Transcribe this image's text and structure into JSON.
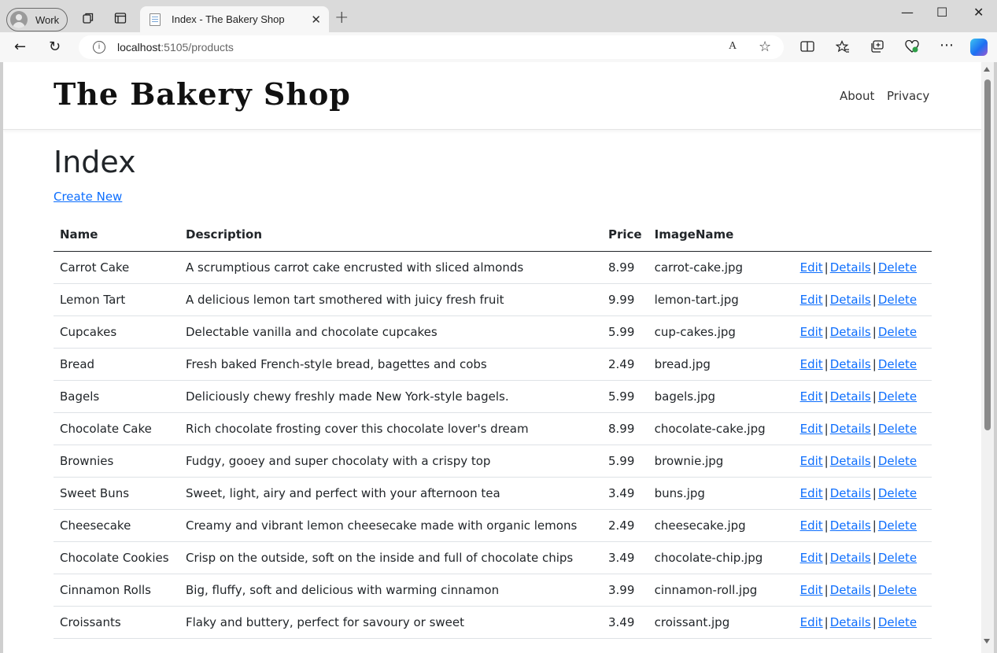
{
  "browser": {
    "profile_label": "Work",
    "tab_title": "Index - The Bakery Shop",
    "close_tab_glyph": "✕",
    "new_tab_glyph": "+",
    "url_host": "localhost",
    "url_path": ":5105/products",
    "read_aloud_glyph": "A",
    "favorite_glyph": "☆",
    "window_controls": {
      "minimize": "—",
      "maximize": "☐",
      "close": "✕"
    },
    "nav_glyphs": {
      "back": "←",
      "refresh": "↻"
    }
  },
  "site": {
    "brand": "The Bakery Shop",
    "nav": {
      "about": "About",
      "privacy": "Privacy"
    }
  },
  "page": {
    "title": "Index",
    "create_new": "Create New"
  },
  "table": {
    "headers": {
      "name": "Name",
      "description": "Description",
      "price": "Price",
      "image": "ImageName"
    },
    "actions": {
      "edit": "Edit",
      "details": "Details",
      "delete": "Delete",
      "separator": "|"
    },
    "rows": [
      {
        "name": "Carrot Cake",
        "description": "A scrumptious carrot cake encrusted with sliced almonds",
        "price": "8.99",
        "image": "carrot-cake.jpg"
      },
      {
        "name": "Lemon Tart",
        "description": "A delicious lemon tart smothered with juicy fresh fruit",
        "price": "9.99",
        "image": "lemon-tart.jpg"
      },
      {
        "name": "Cupcakes",
        "description": "Delectable vanilla and chocolate cupcakes",
        "price": "5.99",
        "image": "cup-cakes.jpg"
      },
      {
        "name": "Bread",
        "description": "Fresh baked French-style bread, bagettes and cobs",
        "price": "2.49",
        "image": "bread.jpg"
      },
      {
        "name": "Bagels",
        "description": "Deliciously chewy freshly made New York-style bagels.",
        "price": "5.99",
        "image": "bagels.jpg"
      },
      {
        "name": "Chocolate Cake",
        "description": "Rich chocolate frosting cover this chocolate lover's dream",
        "price": "8.99",
        "image": "chocolate-cake.jpg"
      },
      {
        "name": "Brownies",
        "description": "Fudgy, gooey and super chocolaty with a crispy top",
        "price": "5.99",
        "image": "brownie.jpg"
      },
      {
        "name": "Sweet Buns",
        "description": "Sweet, light, airy and perfect with your afternoon tea",
        "price": "3.49",
        "image": "buns.jpg"
      },
      {
        "name": "Cheesecake",
        "description": "Creamy and vibrant lemon cheesecake made with organic lemons",
        "price": "2.49",
        "image": "cheesecake.jpg"
      },
      {
        "name": "Chocolate Cookies",
        "description": "Crisp on the outside, soft on the inside and full of chocolate chips",
        "price": "3.49",
        "image": "chocolate-chip.jpg"
      },
      {
        "name": "Cinnamon Rolls",
        "description": "Big, fluffy, soft and delicious with warming cinnamon",
        "price": "3.99",
        "image": "cinnamon-roll.jpg"
      },
      {
        "name": "Croissants",
        "description": "Flaky and buttery, perfect for savoury or sweet",
        "price": "3.49",
        "image": "croissant.jpg"
      }
    ]
  },
  "colors": {
    "link": "#0d6efd",
    "text": "#212529"
  }
}
